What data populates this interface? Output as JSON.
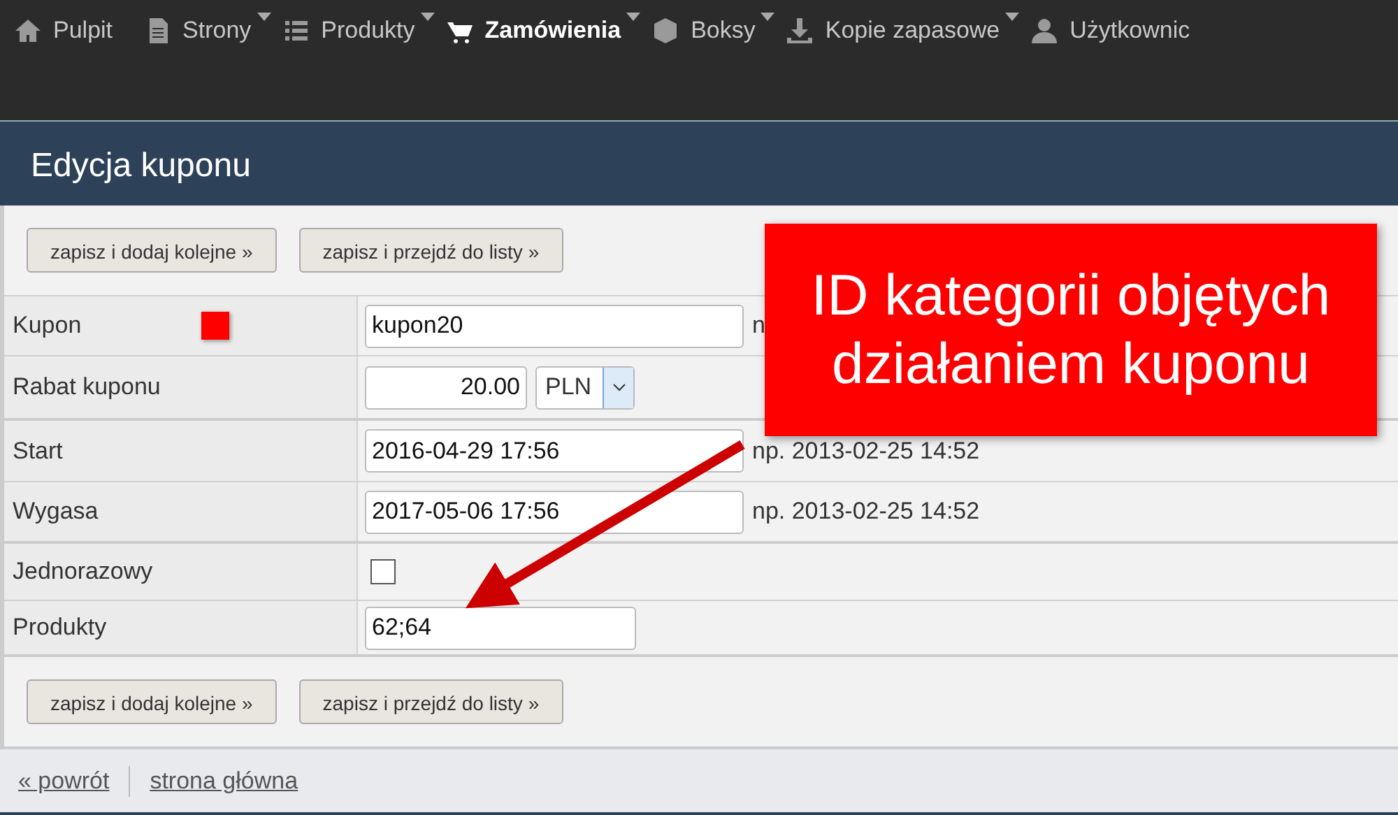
{
  "nav": [
    {
      "label": "Pulpit",
      "has_menu": false,
      "selected": false
    },
    {
      "label": "Strony",
      "has_menu": true,
      "selected": false
    },
    {
      "label": "Produkty",
      "has_menu": true,
      "selected": false
    },
    {
      "label": "Zamówienia",
      "has_menu": true,
      "selected": true
    },
    {
      "label": "Boksy",
      "has_menu": true,
      "selected": false
    },
    {
      "label": "Kopie zapasowe",
      "has_menu": true,
      "selected": false
    },
    {
      "label": "Użytkownic",
      "has_menu": false,
      "selected": false
    }
  ],
  "page_title": "Edycja kuponu",
  "top_buttons": [
    "zapisz i dodaj kolejne »",
    "zapisz i przejdź do listy »"
  ],
  "fields": [
    {
      "kind": "text",
      "label": "Kupon",
      "value": "kupon20",
      "hint": "n",
      "marker": true,
      "wide": true
    },
    {
      "kind": "money",
      "label": "Rabat kuponu",
      "value": "20.00",
      "currency": "PLN"
    },
    {
      "kind": "text",
      "label": "Start",
      "value": "2016-04-29 17:56",
      "hint": "np. 2013-02-25 14:52",
      "wide": true
    },
    {
      "kind": "text",
      "label": "Wygasa",
      "value": "2017-05-06 17:56",
      "hint": "np. 2013-02-25 14:52",
      "wide": true
    },
    {
      "kind": "checkbox",
      "label": "Jednorazowy",
      "checked": false
    },
    {
      "kind": "text",
      "label": "Produkty",
      "value": "62;64",
      "wide": false
    }
  ],
  "bottom_buttons": [
    "zapisz i dodaj kolejne »",
    "zapisz i przejdź do listy »"
  ],
  "footer_links": [
    "« powrót",
    "strona główna"
  ],
  "callout": "ID kategorii objętych działaniem kuponu"
}
